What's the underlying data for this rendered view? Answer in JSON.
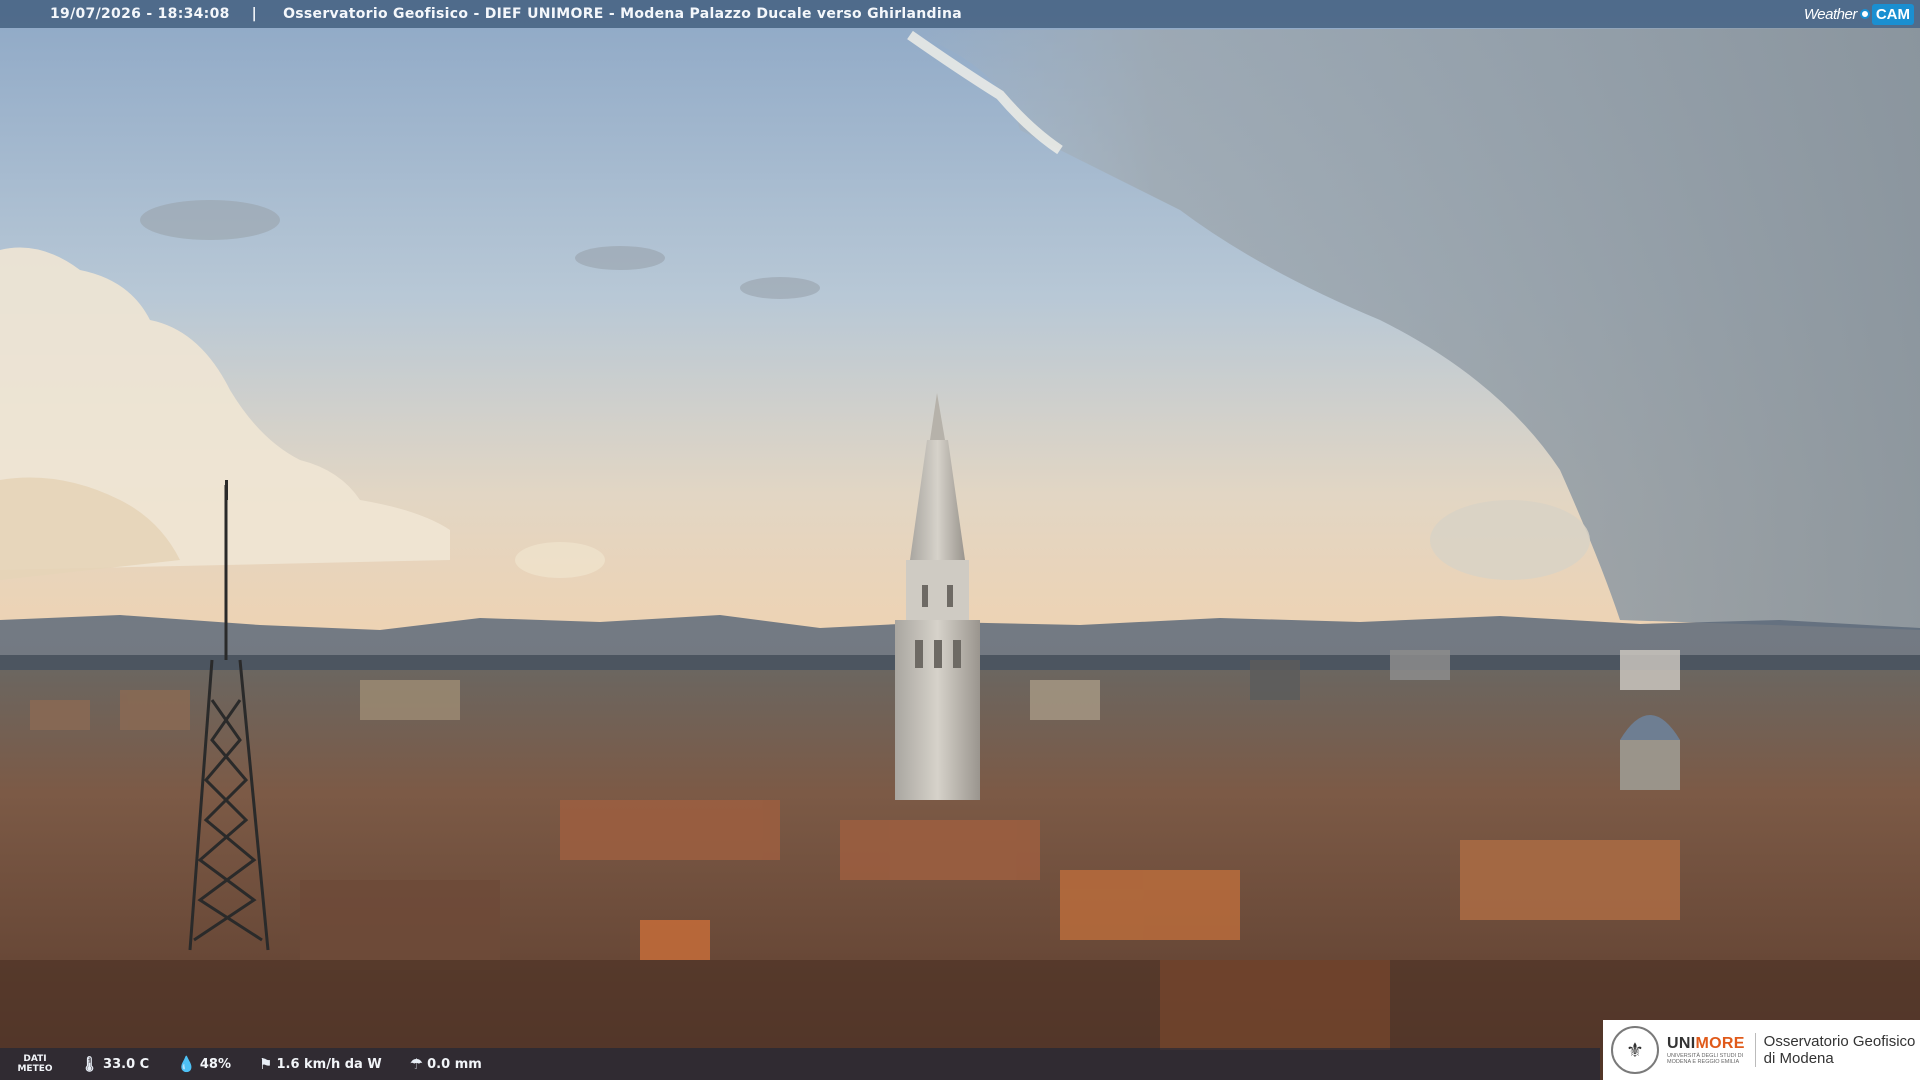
{
  "header": {
    "datetime": "19/07/2026 - 18:34:08",
    "separator": "|",
    "title": "Osservatorio Geofisico - DIEF UNIMORE - Modena Palazzo Ducale verso Ghirlandina"
  },
  "brand": {
    "weather_text": "Weather",
    "cam_text": "CAM"
  },
  "meteo": {
    "label_line1": "DATI",
    "label_line2": "METEO",
    "temperature": "33.0 C",
    "humidity": "48%",
    "wind": "1.6 km/h da W",
    "rain": "0.0 mm",
    "icons": {
      "temperature": "thermometer-icon",
      "humidity": "droplet-icon",
      "wind": "windsock-icon",
      "rain": "rain-gauge-icon"
    }
  },
  "logo": {
    "uni_part1": "UNI",
    "uni_part2": "MORE",
    "uni_small_line1": "UNIVERSITÀ DEGLI STUDI DI",
    "uni_small_line2": "MODENA E REGGIO EMILIA",
    "obs_line1": "Osservatorio Geofisico",
    "obs_line2": "di Modena"
  },
  "colors": {
    "header_bar": "#446080",
    "accent_orange": "#e05a1a",
    "cam_blue": "#1a8fd1"
  }
}
